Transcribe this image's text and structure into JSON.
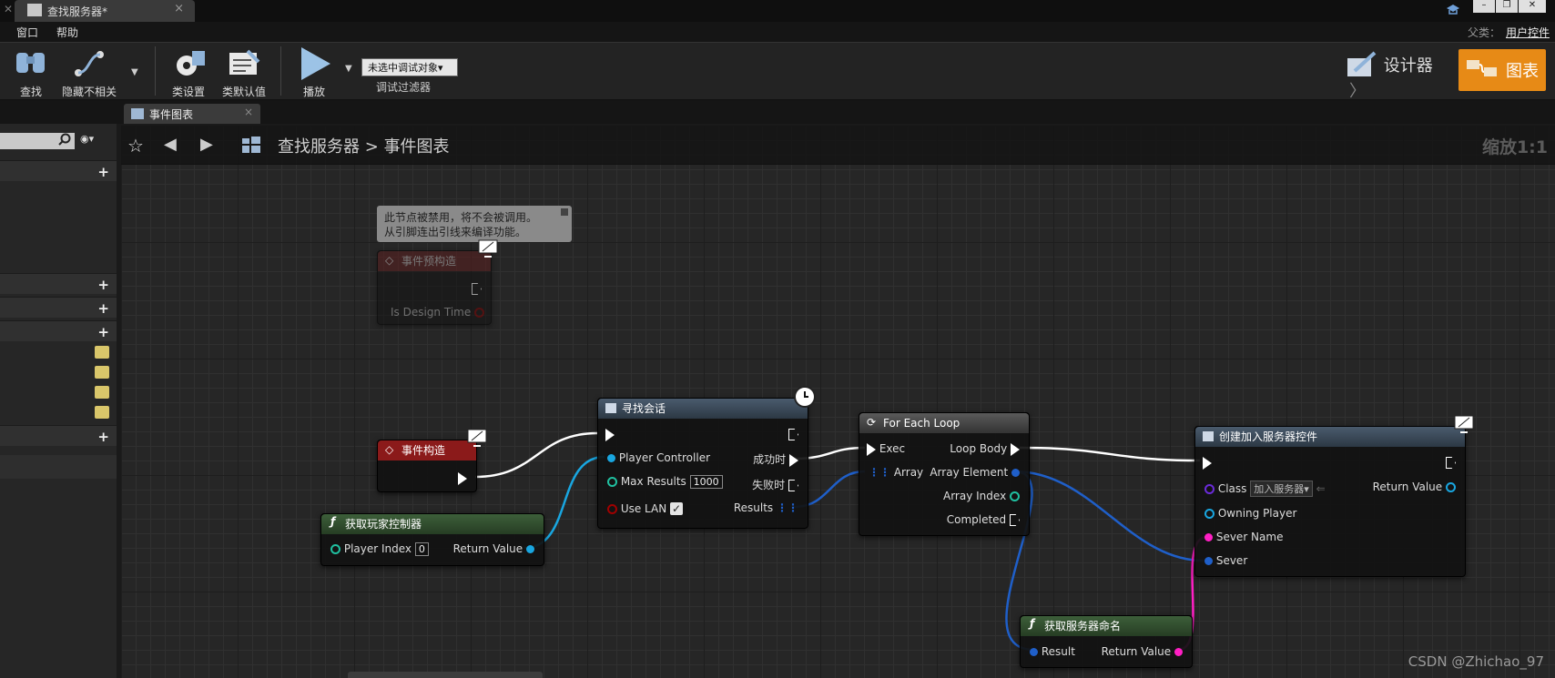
{
  "window": {
    "tab_title": "查找服务器*",
    "tab_close": "×",
    "min": "–",
    "restore": "❐",
    "close": "✕"
  },
  "menu": {
    "items": [
      "窗口",
      "帮助"
    ],
    "parent_label": "父类：",
    "parent_value": "用户控件"
  },
  "toolbar": {
    "find": "查找",
    "hide_unrelated": "隐藏不相关",
    "class_settings": "类设置",
    "class_defaults": "类默认值",
    "play": "播放",
    "debug_select": "未选中调试对象▾",
    "debug_filter": "调试过滤器",
    "designer": "设计器",
    "graph": "图表"
  },
  "doc_tab": {
    "label": "事件图表",
    "close": "×"
  },
  "graph": {
    "breadcrumb_root": "查找服务器",
    "breadcrumb_sep": ">",
    "breadcrumb_leaf": "事件图表",
    "zoom": "缩放1:1"
  },
  "nodes": {
    "comment": {
      "line1": "此节点被禁用，将不会被调用。",
      "line2": "从引脚连出引线来编译功能。"
    },
    "pre_construct": {
      "title": "事件预构造",
      "pin": "Is Design Time"
    },
    "construct": {
      "title": "事件构造"
    },
    "get_player_controller": {
      "title": "获取玩家控制器",
      "in": "Player Index",
      "in_value": "0",
      "out": "Return Value"
    },
    "find_sessions": {
      "title": "寻找会话",
      "in1": "Player Controller",
      "in2": "Max Results",
      "in2_value": "1000",
      "in3": "Use LAN",
      "out1": "成功时",
      "out2": "失败时",
      "out3": "Results"
    },
    "foreach": {
      "title": "For Each Loop",
      "in1": "Exec",
      "in2": "Array",
      "out1": "Loop Body",
      "out2": "Array Element",
      "out3": "Array Index",
      "out4": "Completed"
    },
    "create_widget": {
      "title": "创建加入服务器控件",
      "class_label": "Class",
      "class_value": "加入服务器▾",
      "out": "Return Value",
      "in1": "Owning Player",
      "in2": "Sever Name",
      "in3": "Sever"
    },
    "get_server_name": {
      "title": "获取服务器命名",
      "in": "Result",
      "out": "Return Value"
    }
  },
  "watermark": "CSDN @Zhichao_97",
  "colors": {
    "accent": "#e78a16",
    "event_red": "#8b1a1a",
    "object_blue": "#19a6e0",
    "struct_blue": "#1f5fc9",
    "string_magenta": "#ff1fc4",
    "int_teal": "#20c0a0",
    "bool_red": "#a00000"
  }
}
